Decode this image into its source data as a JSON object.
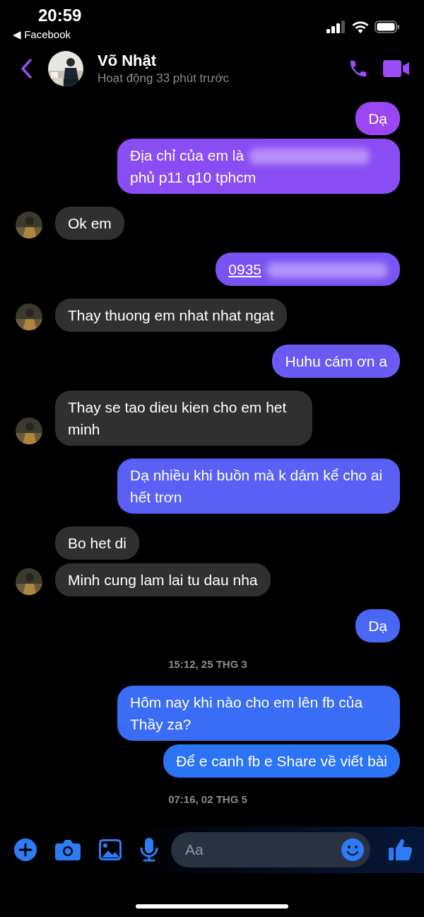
{
  "status_bar": {
    "time": "20:59",
    "back_app": "◀ Facebook"
  },
  "header": {
    "name": "Võ Nhật",
    "status": "Hoạt động 33 phút trước"
  },
  "messages": [
    {
      "kind": "text",
      "outgoing": true,
      "text": "Dạ"
    },
    {
      "kind": "redacted",
      "outgoing": true,
      "segments": [
        {
          "kind": "text",
          "text": "Địa chỉ của em là"
        },
        {
          "kind": "blur"
        },
        {
          "kind": "text",
          "text": "phủ p11 q10 tphcm"
        }
      ]
    },
    {
      "kind": "text",
      "outgoing": false,
      "text": "Ok em",
      "avatar": true
    },
    {
      "kind": "redacted",
      "outgoing": true,
      "segments": [
        {
          "kind": "link",
          "text": "0935"
        },
        {
          "kind": "blur"
        }
      ]
    },
    {
      "kind": "text",
      "outgoing": false,
      "text": "Thay thuong em nhat nhat ngat",
      "avatar": true
    },
    {
      "kind": "text",
      "outgoing": true,
      "text": "Huhu cám ơn a"
    },
    {
      "kind": "text",
      "outgoing": false,
      "text": "Thay se tao dieu kien cho em het minh",
      "avatar": true
    },
    {
      "kind": "text",
      "outgoing": true,
      "text": "Dạ nhiều khi buồn mà k dám kể cho ai hết trơn"
    },
    {
      "kind": "text",
      "outgoing": false,
      "text": "Bo het di",
      "avatar": false
    },
    {
      "kind": "text",
      "outgoing": false,
      "text": "Minh cung lam lai tu dau nha",
      "avatar": true
    },
    {
      "kind": "text",
      "outgoing": true,
      "text": "Dạ"
    },
    {
      "kind": "timestamp",
      "text": "15:12, 25 THG 3"
    },
    {
      "kind": "text",
      "outgoing": true,
      "text": "Hôm nay khi nào cho em lên fb của Thầy za?"
    },
    {
      "kind": "text",
      "outgoing": true,
      "text": "Để e canh fb e Share về viết bài"
    },
    {
      "kind": "timestamp",
      "text": "07:16, 02 THG 5"
    }
  ],
  "composer": {
    "placeholder": "Aa"
  }
}
